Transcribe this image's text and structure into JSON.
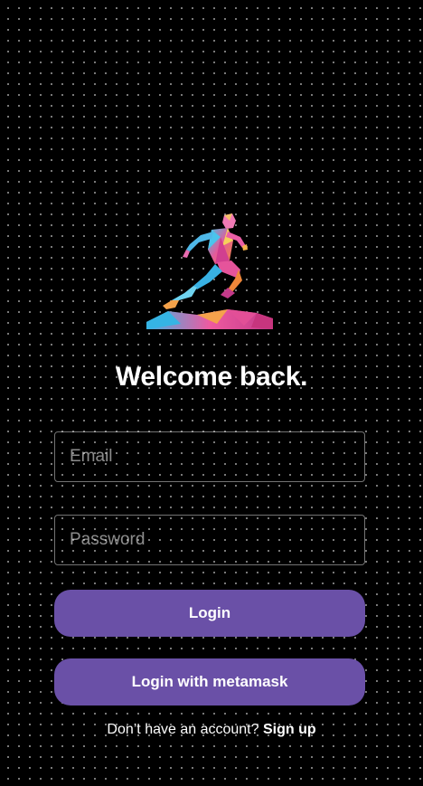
{
  "logo": {
    "icon": "running-man-icon"
  },
  "header": {
    "title": "Welcome back."
  },
  "form": {
    "email_placeholder": "Email",
    "email_value": "",
    "password_placeholder": "Password",
    "password_value": "",
    "login_label": "Login",
    "metamask_label": "Login with metamask"
  },
  "footer": {
    "prompt": "Don’t have an account?",
    "signup_label": "Sign up"
  },
  "colors": {
    "background": "#000000",
    "button": "#6a50a7",
    "text": "#ffffff"
  }
}
